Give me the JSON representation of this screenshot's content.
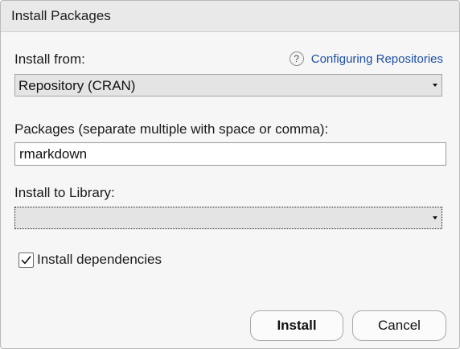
{
  "dialog": {
    "title": "Install Packages"
  },
  "install_from": {
    "label": "Install from:",
    "selected": "Repository (CRAN)"
  },
  "help": {
    "icon": "?",
    "link_text": "Configuring Repositories"
  },
  "packages": {
    "label": "Packages (separate multiple with space or comma):",
    "value": "rmarkdown"
  },
  "library": {
    "label": "Install to Library:",
    "selected": ""
  },
  "dependencies": {
    "label": "Install dependencies",
    "checked": true
  },
  "buttons": {
    "install_label": "Install",
    "cancel_label": "Cancel"
  }
}
